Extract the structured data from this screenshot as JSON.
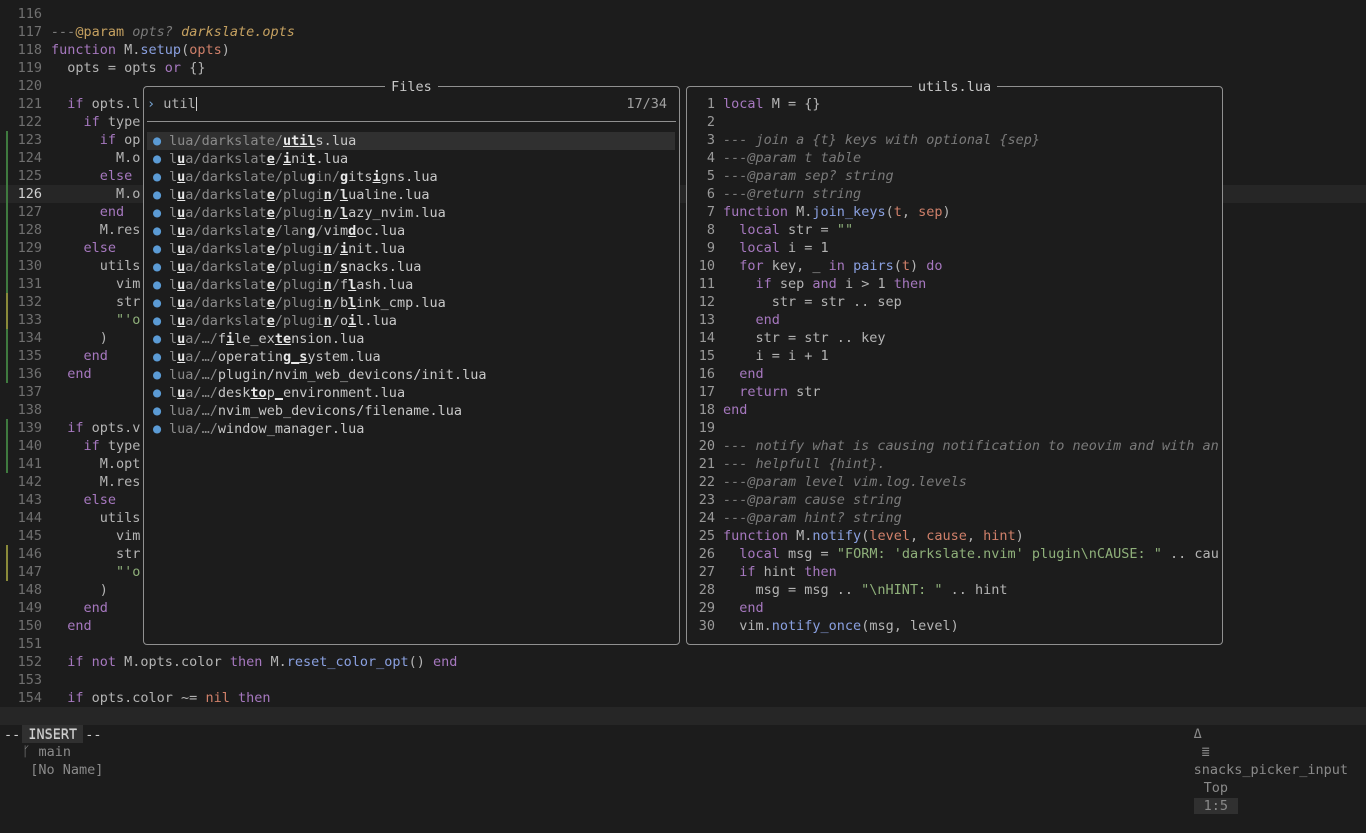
{
  "editor": {
    "lines": [
      {
        "n": "116",
        "t": ""
      },
      {
        "n": "117",
        "segs": [
          [
            "cm",
            "---"
          ],
          [
            "cmtag",
            "@param"
          ],
          [
            "cm",
            " opts? "
          ],
          [
            "ty",
            "darkslate.opts"
          ]
        ]
      },
      {
        "n": "118",
        "segs": [
          [
            "kw",
            "function"
          ],
          [
            "var",
            " M."
          ],
          [
            "fncall",
            "setup"
          ],
          [
            "var",
            "("
          ],
          [
            "par",
            "opts"
          ],
          [
            "var",
            ")"
          ]
        ]
      },
      {
        "n": "119",
        "segs": [
          [
            "var",
            "  opts = opts "
          ],
          [
            "kw",
            "or"
          ],
          [
            "var",
            " {}"
          ]
        ]
      },
      {
        "n": "120",
        "t": ""
      },
      {
        "n": "121",
        "segs": [
          [
            "kw",
            "  if"
          ],
          [
            "var",
            " opts.l"
          ]
        ]
      },
      {
        "n": "122",
        "segs": [
          [
            "kw",
            "    if"
          ],
          [
            "var",
            " type"
          ]
        ]
      },
      {
        "n": "123",
        "segs": [
          [
            "kw",
            "      if"
          ],
          [
            "var",
            " op"
          ]
        ]
      },
      {
        "n": "124",
        "segs": [
          [
            "var",
            "        M.o"
          ]
        ]
      },
      {
        "n": "125",
        "segs": [
          [
            "kw",
            "      else"
          ]
        ]
      },
      {
        "n": "126",
        "segs": [
          [
            "var",
            "        M.o"
          ]
        ],
        "cur": true
      },
      {
        "n": "127",
        "segs": [
          [
            "kw",
            "      end"
          ]
        ]
      },
      {
        "n": "128",
        "segs": [
          [
            "var",
            "      M.res"
          ]
        ]
      },
      {
        "n": "129",
        "segs": [
          [
            "kw",
            "    else"
          ]
        ]
      },
      {
        "n": "130",
        "segs": [
          [
            "var",
            "      utils"
          ]
        ]
      },
      {
        "n": "131",
        "segs": [
          [
            "var",
            "        vim"
          ]
        ]
      },
      {
        "n": "132",
        "segs": [
          [
            "var",
            "        str"
          ]
        ]
      },
      {
        "n": "133",
        "segs": [
          [
            "str",
            "        \"'o"
          ]
        ]
      },
      {
        "n": "134",
        "segs": [
          [
            "var",
            "      )"
          ]
        ]
      },
      {
        "n": "135",
        "segs": [
          [
            "kw",
            "    end"
          ]
        ]
      },
      {
        "n": "136",
        "segs": [
          [
            "kw",
            "  end"
          ]
        ]
      },
      {
        "n": "137",
        "t": ""
      },
      {
        "n": "138",
        "t": ""
      },
      {
        "n": "139",
        "segs": [
          [
            "kw",
            "  if"
          ],
          [
            "var",
            " opts.v"
          ]
        ]
      },
      {
        "n": "140",
        "segs": [
          [
            "kw",
            "    if"
          ],
          [
            "var",
            " type"
          ]
        ]
      },
      {
        "n": "141",
        "segs": [
          [
            "var",
            "      M.opt"
          ]
        ]
      },
      {
        "n": "142",
        "segs": [
          [
            "var",
            "      M.res"
          ]
        ]
      },
      {
        "n": "143",
        "segs": [
          [
            "kw",
            "    else"
          ]
        ]
      },
      {
        "n": "144",
        "segs": [
          [
            "var",
            "      utils"
          ]
        ]
      },
      {
        "n": "145",
        "segs": [
          [
            "var",
            "        vim"
          ]
        ]
      },
      {
        "n": "146",
        "segs": [
          [
            "var",
            "        str"
          ]
        ]
      },
      {
        "n": "147",
        "segs": [
          [
            "str",
            "        \"'o"
          ]
        ]
      },
      {
        "n": "148",
        "segs": [
          [
            "var",
            "      )"
          ]
        ]
      },
      {
        "n": "149",
        "segs": [
          [
            "kw",
            "    end"
          ]
        ]
      },
      {
        "n": "150",
        "segs": [
          [
            "kw",
            "  end"
          ]
        ]
      },
      {
        "n": "151",
        "t": ""
      },
      {
        "n": "152",
        "segs": [
          [
            "kw",
            "  if not"
          ],
          [
            "var",
            " M.opts.color "
          ],
          [
            "kw",
            "then"
          ],
          [
            "var",
            " M."
          ],
          [
            "fncall",
            "reset_color_opt"
          ],
          [
            "var",
            "() "
          ],
          [
            "kw",
            "end"
          ]
        ]
      },
      {
        "n": "153",
        "t": ""
      },
      {
        "n": "154",
        "segs": [
          [
            "kw",
            "  if"
          ],
          [
            "var",
            " opts.color ~= "
          ],
          [
            "num",
            "nil"
          ],
          [
            "kw",
            " then"
          ]
        ]
      }
    ],
    "gutter_marks": {
      "123": "#3f7a3f",
      "124": "#3f7a3f",
      "125": "#3f7a3f",
      "126": "#3f7a3f",
      "127": "#3f7a3f",
      "128": "#3f7a3f",
      "129": "#3f7a3f",
      "130": "#3f7a3f",
      "131": "#3f7a3f",
      "132": "#8a8a3a",
      "133": "#8a8a3a",
      "134": "#3f7a3f",
      "135": "#3f7a3f",
      "136": "#3f7a3f",
      "139": "#3f7a3f",
      "140": "#3f7a3f",
      "141": "#3f7a3f",
      "146": "#8a8a3a",
      "147": "#8a8a3a"
    }
  },
  "picker": {
    "title": "Files",
    "query": "util",
    "count": "17/34",
    "results": [
      {
        "dir": "lua/darkslate/",
        "name": "utils.lua",
        "sel": true,
        "hl": [
          14,
          15,
          16,
          17
        ]
      },
      {
        "dir": "lua/darkslate/",
        "name": "init.lua",
        "hl": [
          1,
          12,
          14,
          17
        ]
      },
      {
        "dir": "lua/darkslate/plugin/",
        "name": "gitsigns.lua",
        "hl": [
          1,
          17,
          21,
          25
        ]
      },
      {
        "dir": "lua/darkslate/plugin/",
        "name": "lualine.lua",
        "hl": [
          1,
          12,
          19,
          21
        ]
      },
      {
        "dir": "lua/darkslate/plugin/",
        "name": "lazy_nvim.lua",
        "hl": [
          1,
          12,
          19,
          21
        ]
      },
      {
        "dir": "lua/darkslate/lang/",
        "name": "vimdoc.lua",
        "hl": [
          1,
          12,
          17,
          22
        ]
      },
      {
        "dir": "lua/darkslate/plugin/",
        "name": "init.lua",
        "hl": [
          1,
          12,
          19,
          21
        ]
      },
      {
        "dir": "lua/darkslate/plugin/",
        "name": "snacks.lua",
        "hl": [
          1,
          12,
          19,
          21
        ]
      },
      {
        "dir": "lua/darkslate/plugin/",
        "name": "flash.lua",
        "hl": [
          1,
          12,
          19,
          22
        ]
      },
      {
        "dir": "lua/darkslate/plugin/",
        "name": "blink_cmp.lua",
        "hl": [
          1,
          12,
          19,
          22
        ]
      },
      {
        "dir": "lua/darkslate/plugin/",
        "name": "oil.lua",
        "hl": [
          1,
          12,
          19,
          22
        ]
      },
      {
        "dir": "lua/…/",
        "name": "file_extension.lua",
        "hl": [
          1,
          7,
          13,
          14
        ]
      },
      {
        "dir": "lua/…/",
        "name": "operating_system.lua",
        "hl": [
          1,
          14,
          15,
          16
        ]
      },
      {
        "dir": "lua/…/",
        "name": "plugin/nvim_web_devicons/init.lua",
        "hl": []
      },
      {
        "dir": "lua/…/",
        "name": "desktop_environment.lua",
        "hl": [
          1,
          10,
          11,
          13
        ]
      },
      {
        "dir": "lua/…/",
        "name": "nvim_web_devicons/filename.lua",
        "hl": []
      },
      {
        "dir": "lua/…/",
        "name": "window_manager.lua",
        "hl": []
      }
    ]
  },
  "preview": {
    "title": "utils.lua",
    "lines": [
      {
        "n": "1",
        "segs": [
          [
            "kw",
            "local"
          ],
          [
            "var",
            " M = {}"
          ]
        ]
      },
      {
        "n": "2",
        "segs": []
      },
      {
        "n": "3",
        "segs": [
          [
            "cm",
            "--- join a {t} keys with optional {sep}"
          ]
        ]
      },
      {
        "n": "4",
        "segs": [
          [
            "cm",
            "---@param t table"
          ]
        ]
      },
      {
        "n": "5",
        "segs": [
          [
            "cm",
            "---@param sep? string"
          ]
        ]
      },
      {
        "n": "6",
        "segs": [
          [
            "cm",
            "---@return string"
          ]
        ]
      },
      {
        "n": "7",
        "segs": [
          [
            "kw",
            "function"
          ],
          [
            "var",
            " M."
          ],
          [
            "fncall",
            "join_keys"
          ],
          [
            "var",
            "("
          ],
          [
            "par",
            "t"
          ],
          [
            "var",
            ", "
          ],
          [
            "par",
            "sep"
          ],
          [
            "var",
            ")"
          ]
        ]
      },
      {
        "n": "8",
        "segs": [
          [
            "kw",
            "  local"
          ],
          [
            "var",
            " str = "
          ],
          [
            "str",
            "\"\""
          ]
        ]
      },
      {
        "n": "9",
        "segs": [
          [
            "kw",
            "  local"
          ],
          [
            "var",
            " i = 1"
          ]
        ]
      },
      {
        "n": "10",
        "segs": [
          [
            "kw",
            "  for"
          ],
          [
            "var",
            " key, _ "
          ],
          [
            "kw",
            "in"
          ],
          [
            "var",
            " "
          ],
          [
            "fncall",
            "pairs"
          ],
          [
            "var",
            "("
          ],
          [
            "par",
            "t"
          ],
          [
            "var",
            ") "
          ],
          [
            "kw",
            "do"
          ]
        ]
      },
      {
        "n": "11",
        "segs": [
          [
            "kw",
            "    if"
          ],
          [
            "var",
            " sep "
          ],
          [
            "kw",
            "and"
          ],
          [
            "var",
            " i > 1 "
          ],
          [
            "kw",
            "then"
          ]
        ]
      },
      {
        "n": "12",
        "segs": [
          [
            "var",
            "      str = str .. sep"
          ]
        ]
      },
      {
        "n": "13",
        "segs": [
          [
            "kw",
            "    end"
          ]
        ]
      },
      {
        "n": "14",
        "segs": [
          [
            "var",
            "    str = str .. key"
          ]
        ]
      },
      {
        "n": "15",
        "segs": [
          [
            "var",
            "    i = i + 1"
          ]
        ]
      },
      {
        "n": "16",
        "segs": [
          [
            "kw",
            "  end"
          ]
        ]
      },
      {
        "n": "17",
        "segs": [
          [
            "kw",
            "  return"
          ],
          [
            "var",
            " str"
          ]
        ]
      },
      {
        "n": "18",
        "segs": [
          [
            "kw",
            "end"
          ]
        ]
      },
      {
        "n": "19",
        "segs": []
      },
      {
        "n": "20",
        "segs": [
          [
            "cm",
            "--- notify what is causing notification to neovim and with an"
          ]
        ]
      },
      {
        "n": "21",
        "segs": [
          [
            "cm",
            "--- helpfull {hint}."
          ]
        ]
      },
      {
        "n": "22",
        "segs": [
          [
            "cm",
            "---@param level vim.log.levels"
          ]
        ]
      },
      {
        "n": "23",
        "segs": [
          [
            "cm",
            "---@param cause string"
          ]
        ]
      },
      {
        "n": "24",
        "segs": [
          [
            "cm",
            "---@param hint? string"
          ]
        ]
      },
      {
        "n": "25",
        "segs": [
          [
            "kw",
            "function"
          ],
          [
            "var",
            " M."
          ],
          [
            "fncall",
            "notify"
          ],
          [
            "var",
            "("
          ],
          [
            "par",
            "level"
          ],
          [
            "var",
            ", "
          ],
          [
            "par",
            "cause"
          ],
          [
            "var",
            ", "
          ],
          [
            "par",
            "hint"
          ],
          [
            "var",
            ")"
          ]
        ]
      },
      {
        "n": "26",
        "segs": [
          [
            "kw",
            "  local"
          ],
          [
            "var",
            " msg = "
          ],
          [
            "str",
            "\"FORM: 'darkslate.nvim' plugin\\nCAUSE: \""
          ],
          [
            "var",
            " .. caus"
          ]
        ]
      },
      {
        "n": "27",
        "segs": [
          [
            "kw",
            "  if"
          ],
          [
            "var",
            " hint "
          ],
          [
            "kw",
            "then"
          ]
        ]
      },
      {
        "n": "28",
        "segs": [
          [
            "var",
            "    msg = msg .. "
          ],
          [
            "str",
            "\"\\nHINT: \""
          ],
          [
            "var",
            " .. hint"
          ]
        ]
      },
      {
        "n": "29",
        "segs": [
          [
            "kw",
            "  end"
          ]
        ]
      },
      {
        "n": "30",
        "segs": [
          [
            "var",
            "  vim."
          ],
          [
            "fncall",
            "notify_once"
          ],
          [
            "var",
            "(msg, level)"
          ]
        ]
      }
    ]
  },
  "statusbar": {
    "mode": "INSERT",
    "branch": "ᚴ main",
    "buffer": "[No Name]",
    "delta_icon": "Δ",
    "filetype_icon": "≣",
    "filetype": "snacks_picker_input",
    "scroll": "Top",
    "position": "1:5"
  },
  "cmdline": "-- INSERT --",
  "colors": {
    "accent": "#5b9bd5",
    "keyword": "#a678bf",
    "string": "#8fb07a",
    "param": "#d0806a"
  }
}
